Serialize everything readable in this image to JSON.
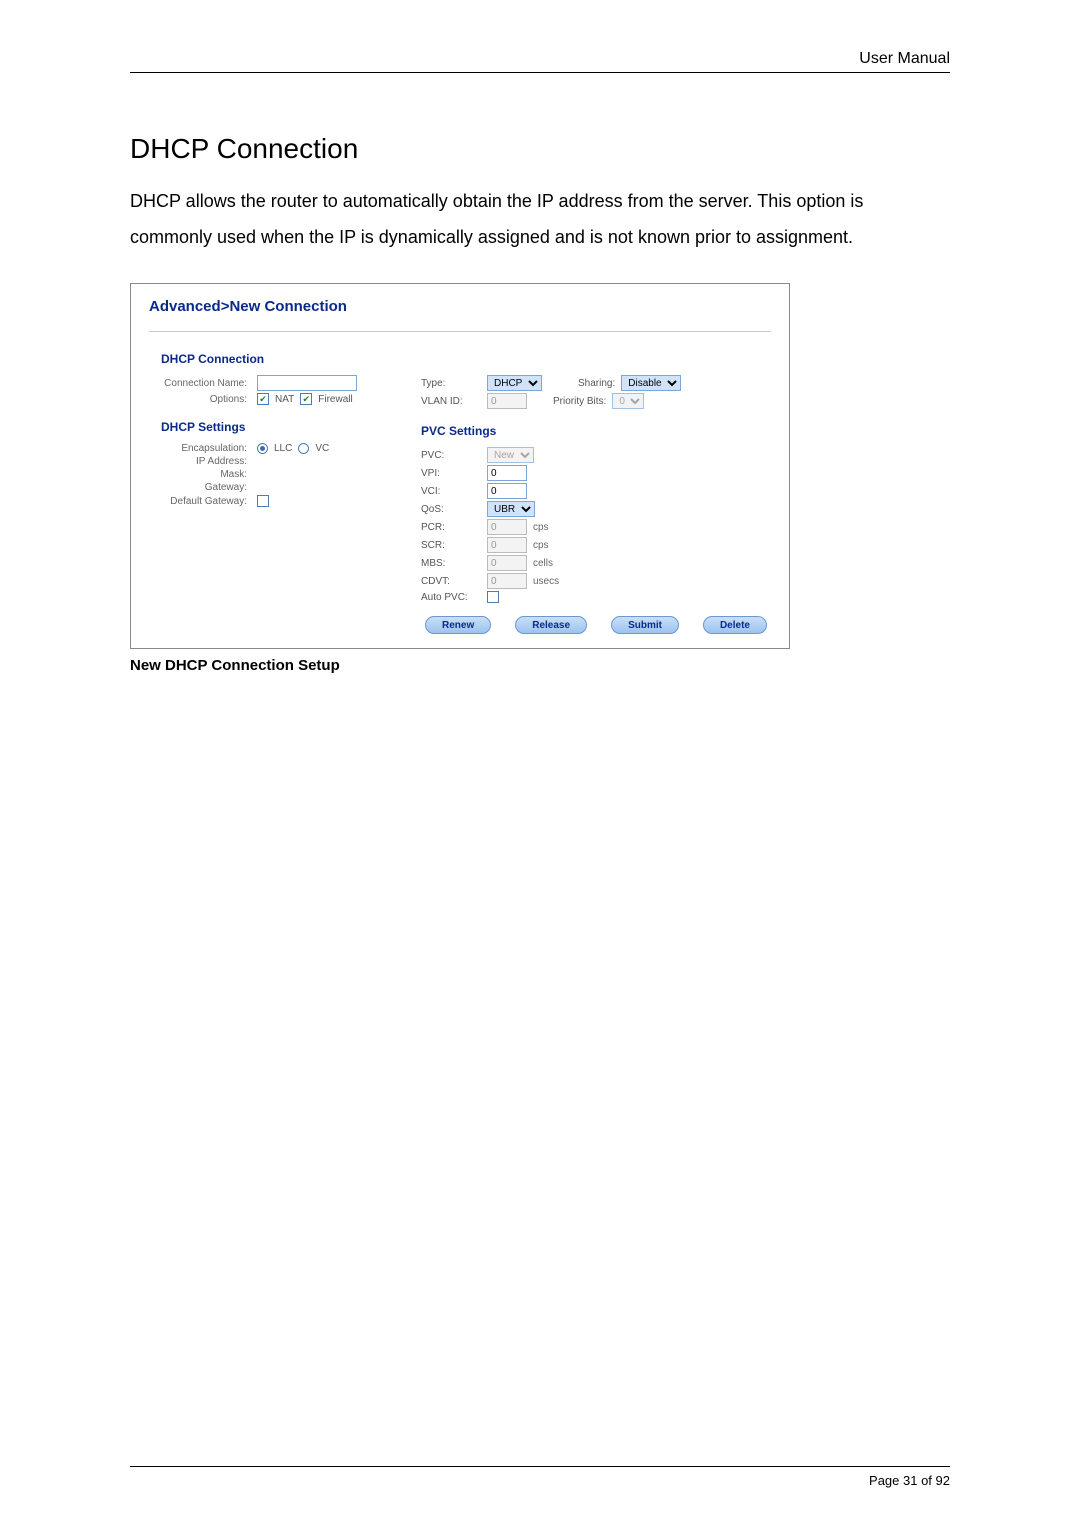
{
  "header": {
    "doc_label": "User Manual"
  },
  "main": {
    "heading": "DHCP Connection",
    "paragraph": "DHCP allows the router to automatically obtain the IP address from the server. This option is commonly used when the IP is dynamically assigned and is not known prior to assignment."
  },
  "shot": {
    "title": "Advanced>New Connection",
    "dhcp_conn": {
      "section_title": "DHCP Connection",
      "conn_name_label": "Connection Name:",
      "conn_name_value": "",
      "options_label": "Options:",
      "nat_label": "NAT",
      "firewall_label": "Firewall",
      "type_label": "Type:",
      "type_value": "DHCP",
      "sharing_label": "Sharing:",
      "sharing_value": "Disable",
      "vlanid_label": "VLAN ID:",
      "vlanid_value": "0",
      "priority_label": "Priority Bits:",
      "priority_value": "0"
    },
    "dhcp_settings": {
      "section_title": "DHCP Settings",
      "encap_label": "Encapsulation:",
      "encap_llc": "LLC",
      "encap_vc": "VC",
      "ip_label": "IP Address:",
      "mask_label": "Mask:",
      "gateway_label": "Gateway:",
      "default_gw_label": "Default Gateway:"
    },
    "pvc": {
      "section_title": "PVC Settings",
      "pvc_label": "PVC:",
      "pvc_value": "New",
      "vpi_label": "VPI:",
      "vpi_value": "0",
      "vci_label": "VCI:",
      "vci_value": "0",
      "qos_label": "QoS:",
      "qos_value": "UBR",
      "pcr_label": "PCR:",
      "pcr_value": "0",
      "pcr_unit": "cps",
      "scr_label": "SCR:",
      "scr_value": "0",
      "scr_unit": "cps",
      "mbs_label": "MBS:",
      "mbs_value": "0",
      "mbs_unit": "cells",
      "cdvt_label": "CDVT:",
      "cdvt_value": "0",
      "cdvt_unit": "usecs",
      "autopvc_label": "Auto PVC:"
    },
    "buttons": {
      "renew": "Renew",
      "release": "Release",
      "submit": "Submit",
      "delete": "Delete"
    }
  },
  "caption": "New DHCP Connection Setup",
  "footer": {
    "page": "Page 31 of 92"
  }
}
